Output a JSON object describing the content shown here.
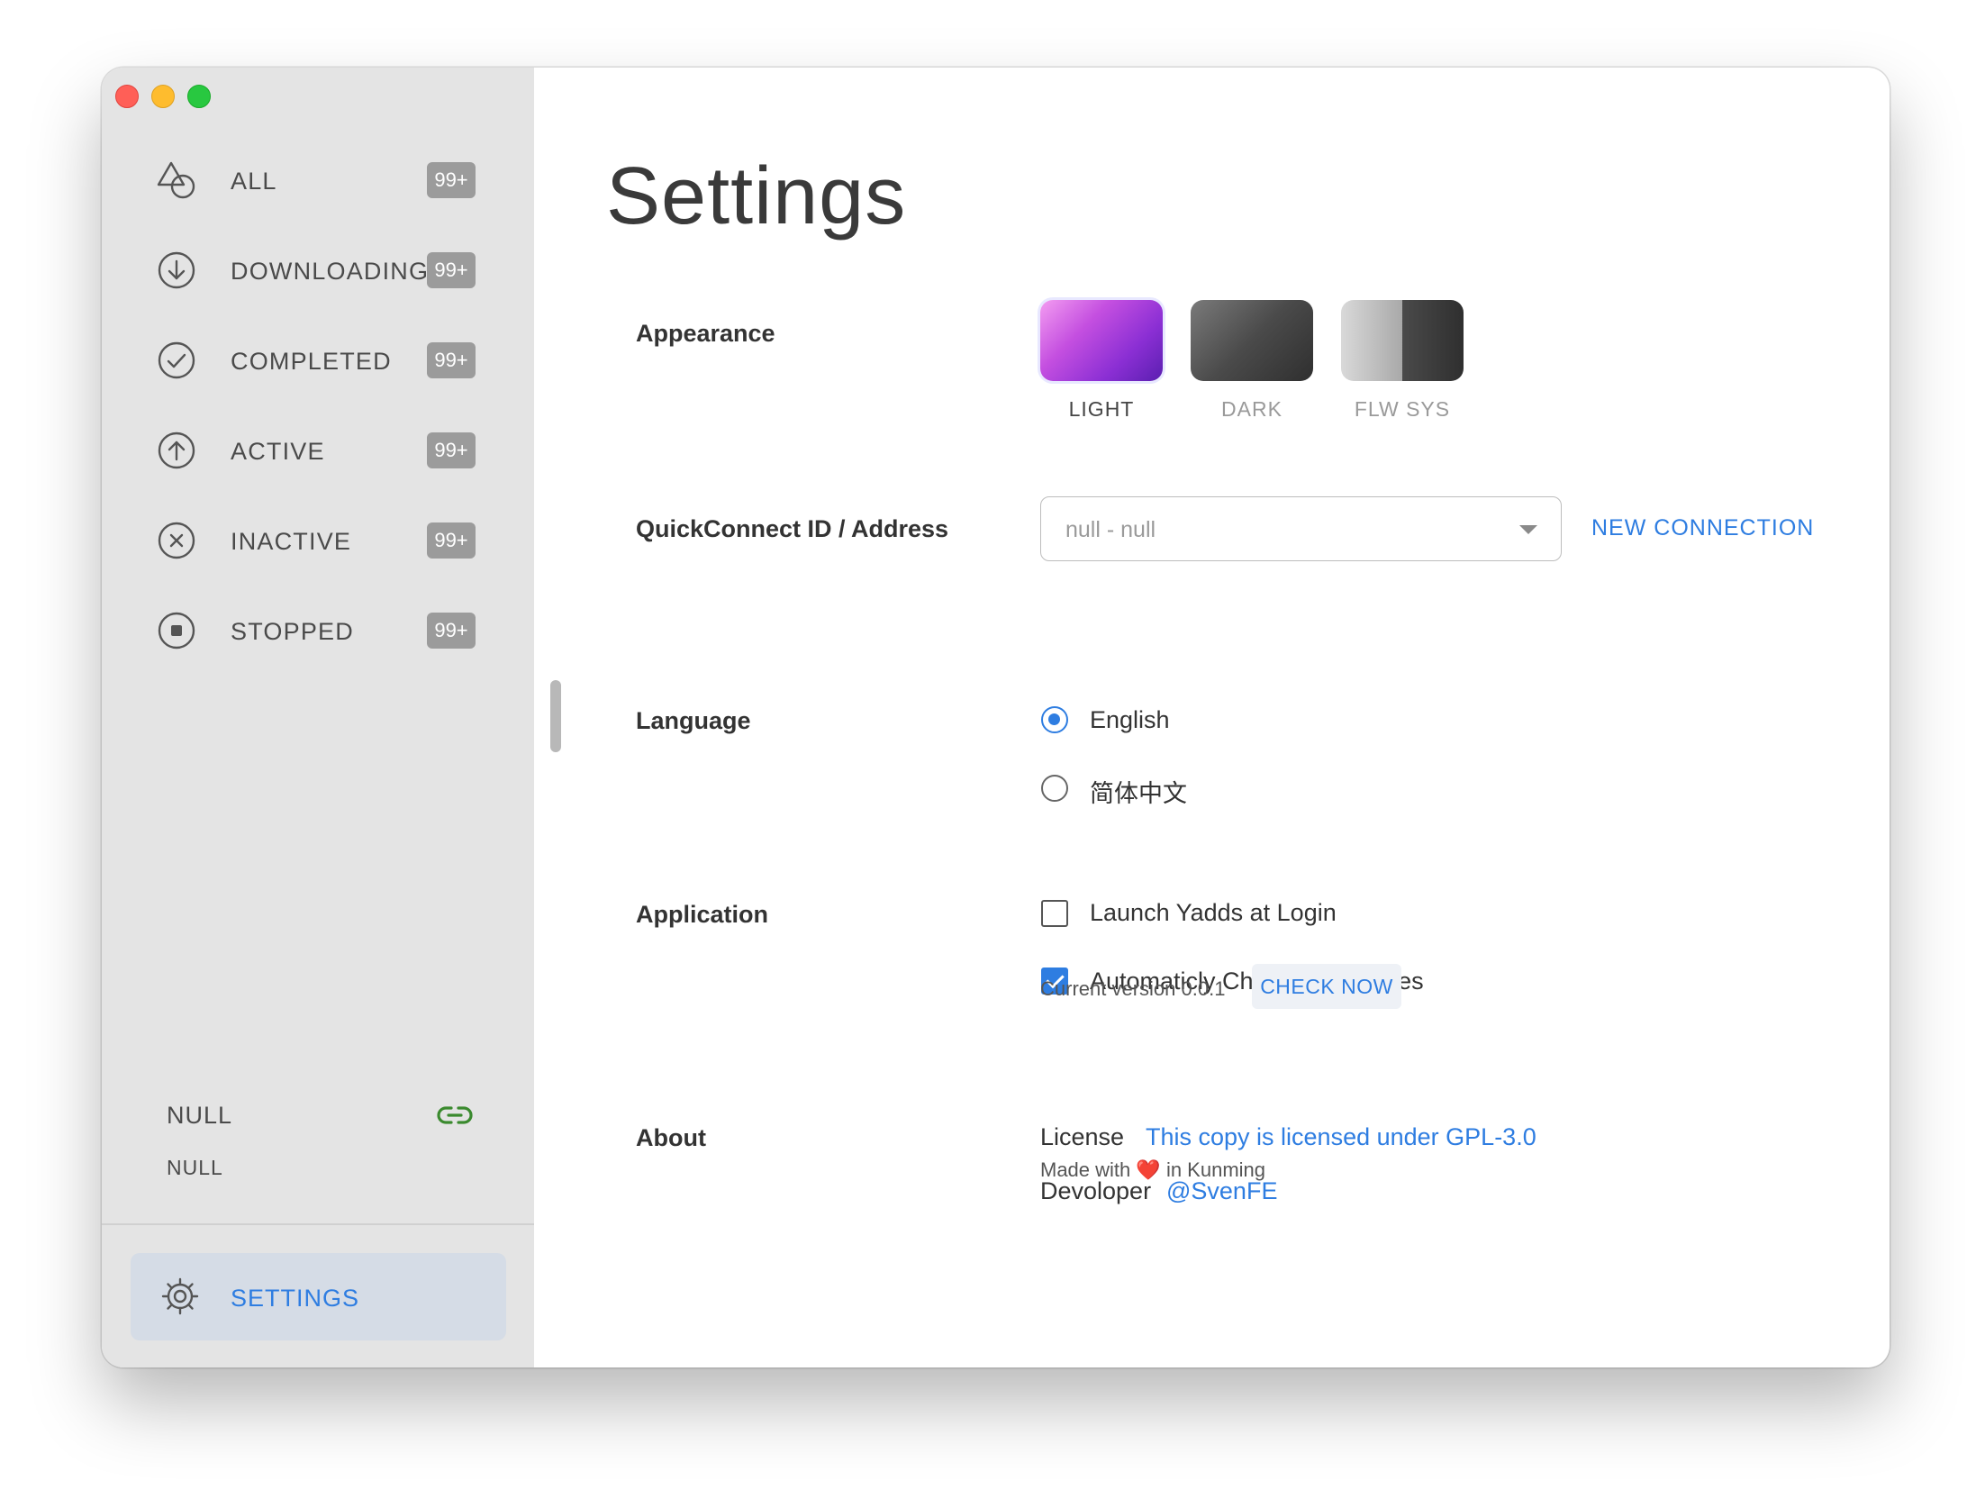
{
  "sidebar": {
    "items": [
      {
        "label": "ALL",
        "badge": "99+",
        "icon": "shapes-icon"
      },
      {
        "label": "DOWNLOADING",
        "badge": "99+",
        "icon": "arrow-down-circle-icon"
      },
      {
        "label": "COMPLETED",
        "badge": "99+",
        "icon": "check-circle-icon"
      },
      {
        "label": "ACTIVE",
        "badge": "99+",
        "icon": "arrow-up-circle-icon"
      },
      {
        "label": "INACTIVE",
        "badge": "99+",
        "icon": "x-circle-icon"
      },
      {
        "label": "STOPPED",
        "badge": "99+",
        "icon": "stop-circle-icon"
      }
    ],
    "server_name": "NULL",
    "server_sub": "NULL",
    "settings_label": "SETTINGS"
  },
  "main": {
    "title": "Settings",
    "appearance": {
      "label": "Appearance",
      "options": [
        "LIGHT",
        "DARK",
        "FLW SYS"
      ],
      "selected": "LIGHT"
    },
    "quickconnect": {
      "label": "QuickConnect ID / Address",
      "value": "null - null",
      "new_connection": "NEW CONNECTION"
    },
    "language": {
      "label": "Language",
      "options": [
        "English",
        "简体中文"
      ],
      "selected": "English"
    },
    "application": {
      "label": "Application",
      "launch_at_login": "Launch Yadds at Login",
      "launch_checked": false,
      "auto_update": "Automaticly Check for Updates",
      "auto_update_checked": true,
      "version_text": "Current version 0.0.1",
      "check_now": "CHECK NOW"
    },
    "about": {
      "label": "About",
      "license_key": "License",
      "license_value": "This copy is licensed under GPL-3.0",
      "developer_key": "Devoloper",
      "developer_value": "@SvenFE",
      "made_prefix": "Made with",
      "made_heart": "❤️",
      "made_suffix": "in Kunming"
    }
  },
  "colors": {
    "accent": "#2e7de1",
    "sidebar_bg": "#e4e4e4",
    "badge_bg": "#9b9b9b",
    "link_green": "#3a8a2e"
  }
}
